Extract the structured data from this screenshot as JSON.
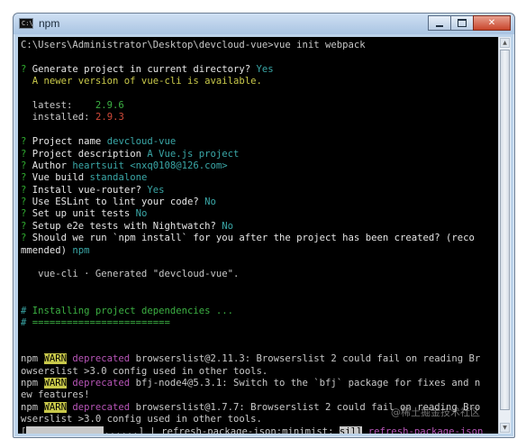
{
  "window": {
    "title": "npm",
    "icon_label": "C:\\",
    "controls": {
      "minimize": "minimize-icon",
      "maximize": "maximize-icon",
      "close_glyph": "✕"
    }
  },
  "terminal": {
    "prompt_line": "C:\\Users\\Administrator\\Desktop\\devcloud-vue>vue init webpack",
    "gen_q_mark": "?",
    "gen_q": " Generate project in current directory?",
    "gen_a": " Yes",
    "newer_version": "  A newer version of vue-cli is available.",
    "latest_label": "  latest:",
    "latest_value": "2.9.6",
    "installed_label": "  installed:",
    "installed_value": "2.9.3",
    "prompts": [
      {
        "mark": "?",
        "q": " Project name",
        "a": " devcloud-vue"
      },
      {
        "mark": "?",
        "q": " Project description",
        "a": " A Vue.js project"
      },
      {
        "mark": "?",
        "q": " Author",
        "a": " heartsuit <nxq0108@126.com>"
      },
      {
        "mark": "?",
        "q": " Vue build",
        "a": " standalone"
      },
      {
        "mark": "?",
        "q": " Install vue-router?",
        "a": " Yes"
      },
      {
        "mark": "?",
        "q": " Use ESLint to lint your code?",
        "a": " No"
      },
      {
        "mark": "?",
        "q": " Set up unit tests",
        "a": " No"
      },
      {
        "mark": "?",
        "q": " Setup e2e tests with Nightwatch?",
        "a": " No"
      }
    ],
    "install_q_mark": "?",
    "install_q_1": " Should we run `npm install` for you after the project has been created? (reco",
    "install_q_2": "mmended)",
    "install_a": " npm",
    "generated": "   vue-cli · Generated \"devcloud-vue\".",
    "installing_hash": "#",
    "installing": " Installing project dependencies ...",
    "sep_hash": "#",
    "separator": " ========================",
    "npm_lines": [
      {
        "prefix": "npm ",
        "tag": "WARN",
        "kind": " deprecated",
        "msg_1": " browserslist@2.11.3: Browserslist 2 could fail on reading Br",
        "msg_2": "owserslist >3.0 config used in other tools."
      },
      {
        "prefix": "npm ",
        "tag": "WARN",
        "kind": " deprecated",
        "msg_1": " bfj-node4@5.3.1: Switch to the `bfj` package for fixes and n",
        "msg_2": "ew features!"
      },
      {
        "prefix": "npm ",
        "tag": "WARN",
        "kind": " deprecated",
        "msg_1": " browserslist@1.7.7: Browserslist 2 could fail on reading Bro",
        "msg_2": "wserslist >3.0 config used in other tools."
      }
    ],
    "progress": {
      "open": "[",
      "dots": "......",
      "close": "] | refresh-package-json:minimist: ",
      "level": "sill",
      "status": " refresh-package-json",
      "fraction": 0.72
    }
  },
  "watermark": "@稀土掘金技术社区"
}
